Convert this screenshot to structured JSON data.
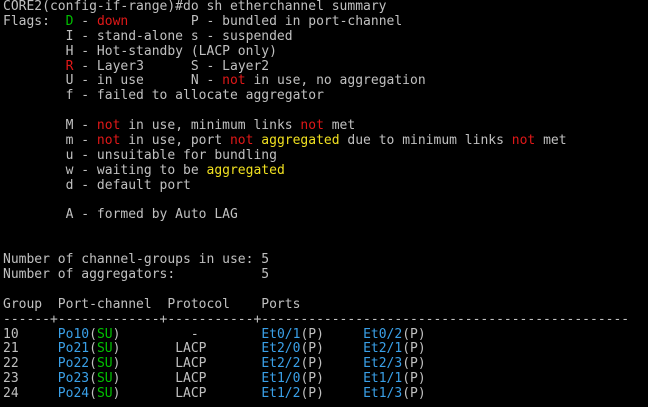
{
  "colors": {
    "background": "#000000",
    "default_text": "#c0c0c0",
    "green": "#00c000",
    "red": "#e01818",
    "yellow": "#f0e020",
    "blue": "#3aa0e8"
  },
  "terminal": {
    "lines": [
      {
        "name": "prompt-line",
        "segs": [
          {
            "t": "CORE2(config-if-range)#do sh etherchannel summary",
            "c": "w"
          }
        ]
      },
      {
        "name": "flags-line-1",
        "segs": [
          {
            "t": "Flags:  ",
            "c": "w"
          },
          {
            "t": "D",
            "c": "g"
          },
          {
            "t": " - ",
            "c": "w"
          },
          {
            "t": "down",
            "c": "r"
          },
          {
            "t": "        P - bundled in port-channel",
            "c": "w"
          }
        ]
      },
      {
        "name": "flags-line-2",
        "segs": [
          {
            "t": "        I - stand-alone s - suspended",
            "c": "w"
          }
        ]
      },
      {
        "name": "flags-line-3",
        "segs": [
          {
            "t": "        H - Hot-standby (LACP only)",
            "c": "w"
          }
        ]
      },
      {
        "name": "flags-line-4",
        "segs": [
          {
            "t": "        ",
            "c": "w"
          },
          {
            "t": "R",
            "c": "r"
          },
          {
            "t": " - Layer3      S - Layer2",
            "c": "w"
          }
        ]
      },
      {
        "name": "flags-line-5",
        "segs": [
          {
            "t": "        U - in use      N - ",
            "c": "w"
          },
          {
            "t": "not",
            "c": "r"
          },
          {
            "t": " in use, no aggregation",
            "c": "w"
          }
        ]
      },
      {
        "name": "flags-line-6",
        "segs": [
          {
            "t": "        f - failed to allocate aggregator",
            "c": "w"
          }
        ]
      },
      {
        "name": "blank-line",
        "segs": [
          {
            "t": "",
            "c": "w"
          }
        ]
      },
      {
        "name": "flags-line-7",
        "segs": [
          {
            "t": "        M - ",
            "c": "w"
          },
          {
            "t": "not",
            "c": "r"
          },
          {
            "t": " in use, minimum links ",
            "c": "w"
          },
          {
            "t": "not",
            "c": "r"
          },
          {
            "t": " met",
            "c": "w"
          }
        ]
      },
      {
        "name": "flags-line-8",
        "segs": [
          {
            "t": "        m - ",
            "c": "w"
          },
          {
            "t": "not",
            "c": "r"
          },
          {
            "t": " in use, port ",
            "c": "w"
          },
          {
            "t": "not",
            "c": "r"
          },
          {
            "t": " ",
            "c": "w"
          },
          {
            "t": "aggregated",
            "c": "y"
          },
          {
            "t": " due to minimum links ",
            "c": "w"
          },
          {
            "t": "not",
            "c": "r"
          },
          {
            "t": " met",
            "c": "w"
          }
        ]
      },
      {
        "name": "flags-line-9",
        "segs": [
          {
            "t": "        u - unsuitable for bundling",
            "c": "w"
          }
        ]
      },
      {
        "name": "flags-line-10",
        "segs": [
          {
            "t": "        w - waiting to be ",
            "c": "w"
          },
          {
            "t": "aggregated",
            "c": "y"
          }
        ]
      },
      {
        "name": "flags-line-11",
        "segs": [
          {
            "t": "        d - default port",
            "c": "w"
          }
        ]
      },
      {
        "name": "blank-line",
        "segs": [
          {
            "t": "",
            "c": "w"
          }
        ]
      },
      {
        "name": "flags-line-12",
        "segs": [
          {
            "t": "        A - formed by Auto LAG",
            "c": "w"
          }
        ]
      },
      {
        "name": "blank-line",
        "segs": [
          {
            "t": "",
            "c": "w"
          }
        ]
      },
      {
        "name": "blank-line",
        "segs": [
          {
            "t": "",
            "c": "w"
          }
        ]
      },
      {
        "name": "channel-groups-count-line",
        "segs": [
          {
            "t": "Number of channel-groups in use: 5",
            "c": "w"
          }
        ]
      },
      {
        "name": "aggregators-count-line",
        "segs": [
          {
            "t": "Number of aggregators:           5",
            "c": "w"
          }
        ]
      },
      {
        "name": "blank-line",
        "segs": [
          {
            "t": "",
            "c": "w"
          }
        ]
      },
      {
        "name": "table-header-line",
        "segs": [
          {
            "t": "Group  Port-channel  Protocol    Ports",
            "c": "w"
          }
        ]
      },
      {
        "name": "table-separator-line",
        "segs": [
          {
            "t": "------+-------------+-----------+-----------------------------------------------",
            "c": "w"
          }
        ]
      },
      {
        "name": "table-row",
        "segs": [
          {
            "t": "10     ",
            "c": "w"
          },
          {
            "t": "Po10",
            "c": "b"
          },
          {
            "t": "(",
            "c": "w"
          },
          {
            "t": "SU",
            "c": "g"
          },
          {
            "t": ")         -        ",
            "c": "w"
          },
          {
            "t": "Et0/1",
            "c": "b"
          },
          {
            "t": "(P)     ",
            "c": "w"
          },
          {
            "t": "Et0/2",
            "c": "b"
          },
          {
            "t": "(P)",
            "c": "w"
          }
        ]
      },
      {
        "name": "table-row",
        "segs": [
          {
            "t": "21     ",
            "c": "w"
          },
          {
            "t": "Po21",
            "c": "b"
          },
          {
            "t": "(",
            "c": "w"
          },
          {
            "t": "SU",
            "c": "g"
          },
          {
            "t": ")       LACP       ",
            "c": "w"
          },
          {
            "t": "Et2/0",
            "c": "b"
          },
          {
            "t": "(P)     ",
            "c": "w"
          },
          {
            "t": "Et2/1",
            "c": "b"
          },
          {
            "t": "(P)",
            "c": "w"
          }
        ]
      },
      {
        "name": "table-row",
        "segs": [
          {
            "t": "22     ",
            "c": "w"
          },
          {
            "t": "Po22",
            "c": "b"
          },
          {
            "t": "(",
            "c": "w"
          },
          {
            "t": "SU",
            "c": "g"
          },
          {
            "t": ")       LACP       ",
            "c": "w"
          },
          {
            "t": "Et2/2",
            "c": "b"
          },
          {
            "t": "(P)     ",
            "c": "w"
          },
          {
            "t": "Et2/3",
            "c": "b"
          },
          {
            "t": "(P)",
            "c": "w"
          }
        ]
      },
      {
        "name": "table-row",
        "segs": [
          {
            "t": "23     ",
            "c": "w"
          },
          {
            "t": "Po23",
            "c": "b"
          },
          {
            "t": "(",
            "c": "w"
          },
          {
            "t": "SU",
            "c": "g"
          },
          {
            "t": ")       LACP       ",
            "c": "w"
          },
          {
            "t": "Et1/0",
            "c": "b"
          },
          {
            "t": "(P)     ",
            "c": "w"
          },
          {
            "t": "Et1/1",
            "c": "b"
          },
          {
            "t": "(P)",
            "c": "w"
          }
        ]
      },
      {
        "name": "table-row",
        "segs": [
          {
            "t": "24     ",
            "c": "w"
          },
          {
            "t": "Po24",
            "c": "b"
          },
          {
            "t": "(",
            "c": "w"
          },
          {
            "t": "SU",
            "c": "g"
          },
          {
            "t": ")       LACP       ",
            "c": "w"
          },
          {
            "t": "Et1/2",
            "c": "b"
          },
          {
            "t": "(P)     ",
            "c": "w"
          },
          {
            "t": "Et1/3",
            "c": "b"
          },
          {
            "t": "(P)",
            "c": "w"
          }
        ]
      }
    ]
  }
}
